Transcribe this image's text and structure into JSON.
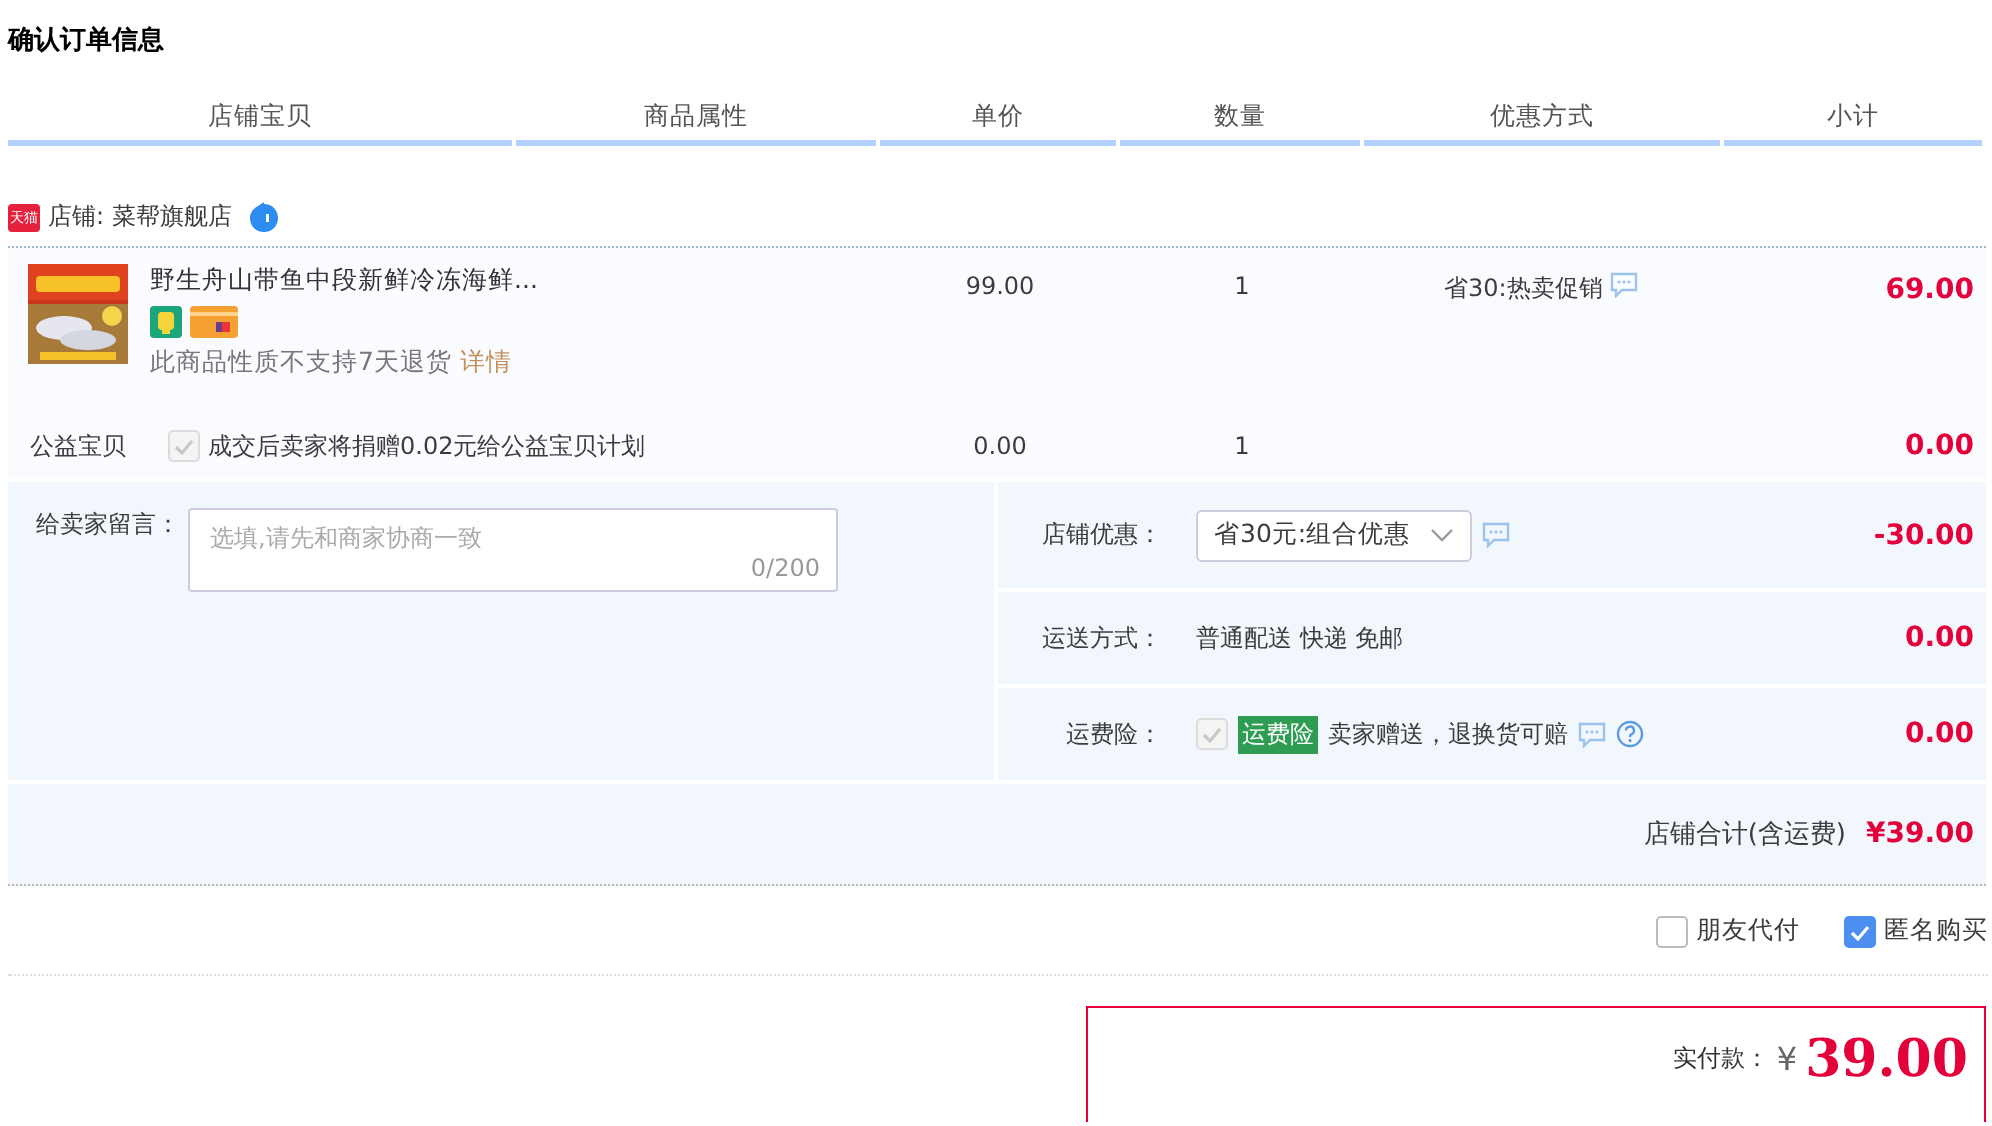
{
  "page_title": "确认订单信息",
  "columns": [
    "店铺宝贝",
    "商品属性",
    "单价",
    "数量",
    "优惠方式",
    "小计"
  ],
  "store": {
    "badge": "天猫",
    "label": "店铺: 菜帮旗舰店"
  },
  "items": [
    {
      "kind": "product",
      "name": "野生舟山带鱼中段新鲜冷冻海鲜...",
      "note": "此商品性质不支持7天退货",
      "note_link": "详情",
      "price": "99.00",
      "quantity": "1",
      "promotion": "省30:热卖促销",
      "subtotal": "69.00"
    },
    {
      "kind": "charity",
      "label": "公益宝贝",
      "checked": true,
      "disabled": true,
      "text": "成交后卖家将捐赠0.02元给公益宝贝计划",
      "price": "0.00",
      "quantity": "1",
      "subtotal": "0.00"
    }
  ],
  "message": {
    "label": "给卖家留言：",
    "placeholder": "选填,请先和商家协商一致",
    "counter": "0/200"
  },
  "options": [
    {
      "kind": "select",
      "label": "店铺优惠：",
      "value": "省30元:组合优惠",
      "amount": "-30.00"
    },
    {
      "kind": "text",
      "label": "运送方式：",
      "value": "普通配送 快递 免邮",
      "amount": "0.00"
    },
    {
      "kind": "insurance",
      "label": "运费险：",
      "checked": true,
      "disabled": true,
      "tag": "运费险",
      "value": "卖家赠送，退换货可赔",
      "amount": "0.00"
    }
  ],
  "store_total": {
    "label": "店铺合计(含运费)",
    "amount": "¥39.00"
  },
  "extras": [
    {
      "label": "朋友代付",
      "checked": false
    },
    {
      "label": "匿名购买",
      "checked": true
    }
  ],
  "payment": {
    "label": "实付款：",
    "currency": "¥",
    "amount": "39.00"
  }
}
